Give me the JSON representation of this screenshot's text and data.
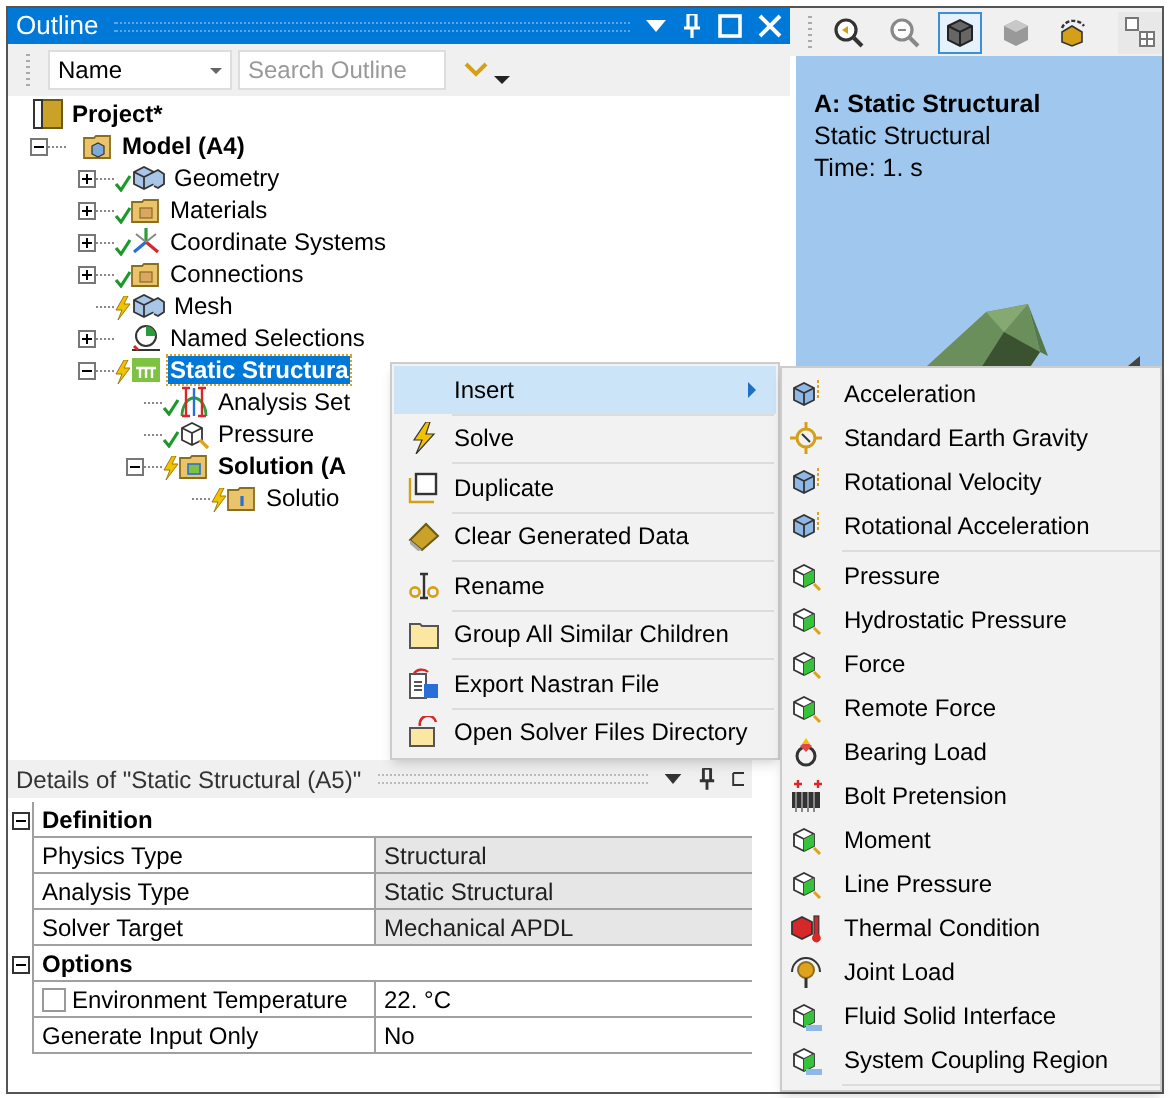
{
  "outline": {
    "title": "Outline",
    "sort_field": "Name",
    "search": {
      "placeholder": "Search Outline"
    },
    "tree": [
      {
        "label": "Project*",
        "kind": "project",
        "selected": false,
        "children": [
          {
            "label": "Model (A4)",
            "kind": "model",
            "selected": false,
            "expanded": true,
            "children": [
              {
                "label": "Geometry",
                "kind": "geometry",
                "up_to_date": true,
                "selected": false,
                "expanded": false
              },
              {
                "label": "Materials",
                "kind": "folder",
                "up_to_date": true,
                "selected": false,
                "expanded": false
              },
              {
                "label": "Coordinate Systems",
                "kind": "axes",
                "up_to_date": true,
                "selected": false,
                "expanded": false
              },
              {
                "label": "Connections",
                "kind": "folder",
                "up_to_date": true,
                "selected": false,
                "expanded": false
              },
              {
                "label": "Mesh",
                "kind": "geometry",
                "up_to_date": false,
                "selected": false
              },
              {
                "label": "Named Selections",
                "kind": "selection",
                "selected": false,
                "expanded": false
              },
              {
                "label": "Static Structura",
                "kind": "analysis",
                "up_to_date": false,
                "selected": true,
                "expanded": true,
                "children": [
                  {
                    "label": "Analysis Set",
                    "kind": "settings",
                    "up_to_date": true,
                    "selected": false
                  },
                  {
                    "label": "Pressure",
                    "kind": "load",
                    "up_to_date": true,
                    "selected": false
                  },
                  {
                    "label": "Solution (A",
                    "kind": "solution",
                    "up_to_date": false,
                    "selected": false,
                    "expanded": true,
                    "children": [
                      {
                        "label": "Solutio",
                        "kind": "info",
                        "up_to_date": false,
                        "selected": false
                      }
                    ]
                  }
                ]
              }
            ]
          }
        ]
      }
    ]
  },
  "graphics": {
    "toolbar": [
      {
        "kind": "zoom-in",
        "selected": false
      },
      {
        "kind": "zoom-out",
        "selected": false
      },
      {
        "kind": "solid",
        "selected": true
      },
      {
        "kind": "shaded",
        "selected": false
      },
      {
        "kind": "rotate",
        "selected": false
      },
      {
        "kind": "layout",
        "selected": false
      }
    ],
    "title": "A: Static Structural",
    "subtitle": "Static Structural",
    "time": "Time: 1. s"
  },
  "context_menu": {
    "items": [
      {
        "label": "Insert",
        "kind": "submenu",
        "selected": true
      },
      {
        "label": "Solve",
        "kind": "solve",
        "selected": false
      },
      {
        "label": "Duplicate",
        "kind": "duplicate",
        "selected": false
      },
      {
        "label": "Clear Generated Data",
        "kind": "eraser",
        "selected": false
      },
      {
        "label": "Rename",
        "kind": "rename",
        "selected": false
      },
      {
        "label": "Group All Similar Children",
        "kind": "folder",
        "selected": false
      },
      {
        "label": "Export Nastran File",
        "kind": "export",
        "selected": false
      },
      {
        "label": "Open Solver Files Directory",
        "kind": "open",
        "selected": false
      }
    ]
  },
  "submenu": {
    "items": [
      {
        "label": "Acceleration",
        "kind": "body",
        "selected": false
      },
      {
        "label": "Standard Earth Gravity",
        "kind": "gravity",
        "selected": false
      },
      {
        "label": "Rotational Velocity",
        "kind": "body",
        "selected": false
      },
      {
        "label": "Rotational Acceleration",
        "kind": "body",
        "selected": false
      },
      {
        "label": "Pressure",
        "kind": "surface",
        "selected": false
      },
      {
        "label": "Hydrostatic Pressure",
        "kind": "surface",
        "selected": false
      },
      {
        "label": "Force",
        "kind": "surface",
        "selected": false
      },
      {
        "label": "Remote Force",
        "kind": "surface",
        "selected": false
      },
      {
        "label": "Bearing Load",
        "kind": "bearing",
        "selected": false
      },
      {
        "label": "Bolt Pretension",
        "kind": "bolt",
        "selected": false
      },
      {
        "label": "Moment",
        "kind": "surface",
        "selected": false
      },
      {
        "label": "Line Pressure",
        "kind": "surface",
        "selected": false
      },
      {
        "label": "Thermal Condition",
        "kind": "thermal",
        "selected": false
      },
      {
        "label": "Joint Load",
        "kind": "joint",
        "selected": false
      },
      {
        "label": "Fluid Solid Interface",
        "kind": "interface",
        "selected": false
      },
      {
        "label": "System Coupling Region",
        "kind": "interface",
        "selected": false
      }
    ]
  },
  "details": {
    "title": "Details of \"Static Structural (A5)\"",
    "sections": [
      {
        "title": "Definition",
        "expanded": true,
        "rows": [
          {
            "label": "Physics Type",
            "value": "Structural",
            "disabled": true
          },
          {
            "label": "Analysis Type",
            "value": "Static Structural",
            "disabled": true
          },
          {
            "label": "Solver Target",
            "value": "Mechanical APDL",
            "disabled": true
          }
        ]
      },
      {
        "title": "Options",
        "expanded": true,
        "rows": [
          {
            "label": "Environment Temperature",
            "value": "22. °C",
            "disabled": false,
            "checked": false
          },
          {
            "label": "Generate Input Only",
            "value": "No",
            "disabled": false
          }
        ]
      }
    ]
  }
}
